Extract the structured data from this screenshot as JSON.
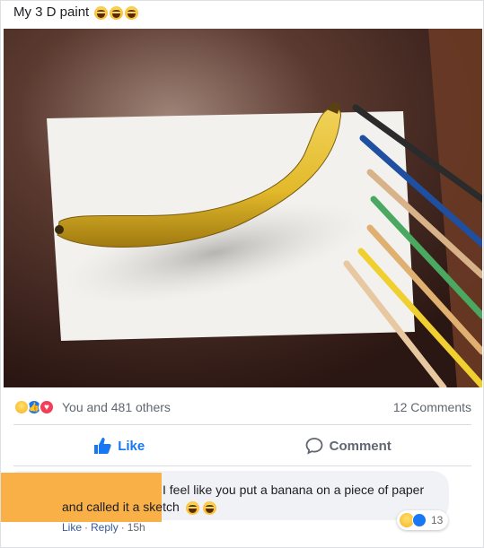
{
  "post": {
    "text": "My 3 D paint",
    "emoji_count": 3,
    "photo_alt_icon": "photo-banana-on-paper-with-pencils"
  },
  "reactions": {
    "icons": [
      "haha-reaction-icon",
      "like-reaction-icon",
      "love-reaction-icon"
    ],
    "summary": "You and 481 others",
    "comments_count": "12 Comments"
  },
  "actions": {
    "like_label": "Like",
    "comment_label": "Comment"
  },
  "comment": {
    "line1": "I feel like you put a banana on a piece of paper",
    "line2": "and called it a sketch",
    "emoji_count": 2,
    "reaction_count": "13",
    "like_label": "Like",
    "separator1": "·",
    "reply_label": "Reply",
    "separator2": "·",
    "time": "15h"
  },
  "colors": {
    "fb_blue": "#1877f2",
    "redaction": "#f9b046",
    "paper": "#f2f1ee",
    "banana": "#e8c53a"
  }
}
